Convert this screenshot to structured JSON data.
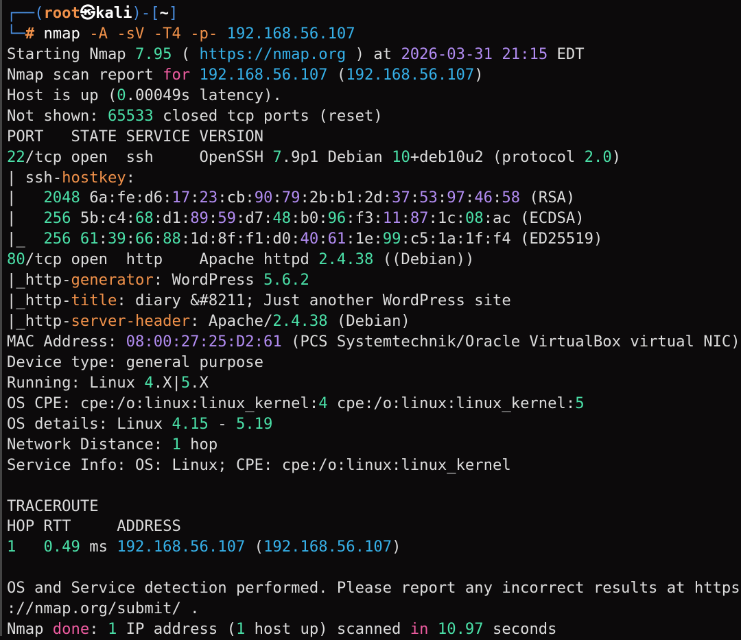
{
  "window": {
    "type": "terminal"
  },
  "prompt": {
    "user": "root",
    "at_symbol": "㉿",
    "host": "kali",
    "dir": "~",
    "command": "nmap",
    "args": [
      "-A",
      "-sV",
      "-T4",
      "-p-"
    ],
    "target": "192.168.56.107"
  },
  "output": {
    "start": {
      "tool": "Nmap",
      "version": "7.95",
      "url": "https://nmap.org",
      "date": "2026-03-31",
      "time": "21:15",
      "tz": "EDT"
    },
    "report_ip": "192.168.56.107",
    "latency": "0.00049s",
    "closed_ports": "65533",
    "header": "PORT   STATE SERVICE VERSION",
    "ssh": {
      "port": "22",
      "proto": "/tcp",
      "state": "open",
      "service": "ssh",
      "product": "OpenSSH",
      "version": "7.9p1",
      "os": "Debian",
      "ver2": "10",
      "deb": "+deb10u2",
      "protocol": "2.0",
      "hostkey_label": "ssh-hostkey:",
      "keys": [
        {
          "bits": "2048",
          "type": "(RSA)"
        },
        {
          "bits": "256",
          "type": "(ECDSA)"
        },
        {
          "bits": "256",
          "type": "(ED25519)"
        }
      ]
    },
    "http": {
      "port": "80",
      "proto": "/tcp",
      "state": "open",
      "service": "http",
      "product": "Apache httpd",
      "version": "2.4.38",
      "os": "((Debian))",
      "generator": "WordPress",
      "generator_version": "5.6.2",
      "title": "diary &#8211; Just another WordPress site",
      "server": "Apache/",
      "server_version": "2.4.38",
      "server_os": "(Debian)"
    },
    "mac": {
      "address": "08:00:27:25:D2:61",
      "vendor": "(PCS Systemtechnik/Oracle VirtualBox virtual NIC)"
    },
    "device_type": "general purpose",
    "running": {
      "a": "4",
      "b": "5"
    },
    "os_cpe": {
      "a": "4",
      "b": "5"
    },
    "os_details": {
      "from": "4.15",
      "to": "5.19"
    },
    "distance": "1",
    "service_info": "OS: Linux; CPE: cpe:/o:linux:linux_kernel",
    "traceroute": {
      "title": "TRACEROUTE",
      "header": "HOP RTT     ADDRESS",
      "hop": "1",
      "rtt": "0.49",
      "unit": "ms",
      "ip": "192.168.56.107"
    },
    "footer1": "OS and Service detection performed. Please report any incorrect results at https",
    "footer2": "://nmap.org/submit/ .",
    "done": {
      "ips": "1",
      "hosts": "1",
      "seconds": "10.97"
    }
  },
  "colors": {
    "background": "#0c0a0b",
    "text": "#dcdcdc",
    "number": "#4be0a8",
    "hex": "#b28cf2",
    "ip": "#36b0e8",
    "keyword": "#ee5ca0",
    "script": "#f0914a",
    "prompt": "#4a8fe0"
  }
}
